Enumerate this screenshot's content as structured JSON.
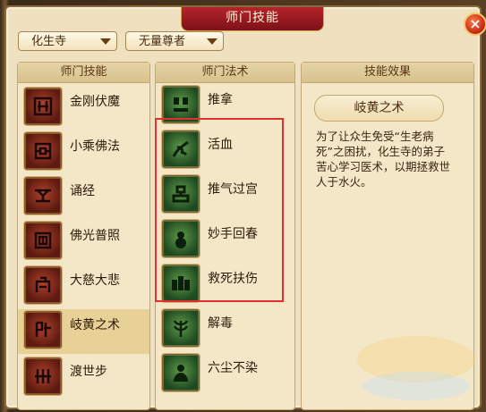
{
  "window": {
    "title": "师门技能",
    "close_label": "×"
  },
  "filters": {
    "school": "化生寺",
    "master": "无量尊者"
  },
  "columns": {
    "skills": "师门技能",
    "spells": "师门法术",
    "effect": "技能效果"
  },
  "skills": [
    {
      "label": "金刚伏魔",
      "icon": "vajra-seal-icon"
    },
    {
      "label": "小乘佛法",
      "icon": "dharma-seal-icon"
    },
    {
      "label": "诵经",
      "icon": "sutra-seal-icon"
    },
    {
      "label": "佛光普照",
      "icon": "buddha-light-seal-icon"
    },
    {
      "label": "大慈大悲",
      "icon": "compassion-seal-icon"
    },
    {
      "label": "岐黄之术",
      "icon": "medicine-seal-icon",
      "selected": true
    },
    {
      "label": "渡世步",
      "icon": "step-seal-icon"
    }
  ],
  "spells": [
    {
      "label": "推拿",
      "icon": "massage-icon"
    },
    {
      "label": "活血",
      "icon": "blood-circulation-icon"
    },
    {
      "label": "推气过宫",
      "icon": "qi-push-icon"
    },
    {
      "label": "妙手回春",
      "icon": "gourd-icon"
    },
    {
      "label": "救死扶伤",
      "icon": "rescue-icon"
    },
    {
      "label": "解毒",
      "icon": "herb-icon"
    },
    {
      "label": "六尘不染",
      "icon": "monk-icon"
    }
  ],
  "effect": {
    "title": "岐黄之术",
    "description": "为了让众生免受“生老病死”之困扰，化生寺的弟子苦心学习医术，以期拯救世人于水火。"
  },
  "colors": {
    "accent_red": "#b3242a",
    "highlight": "#e03030",
    "panel_bg": "#f3e7c8"
  }
}
